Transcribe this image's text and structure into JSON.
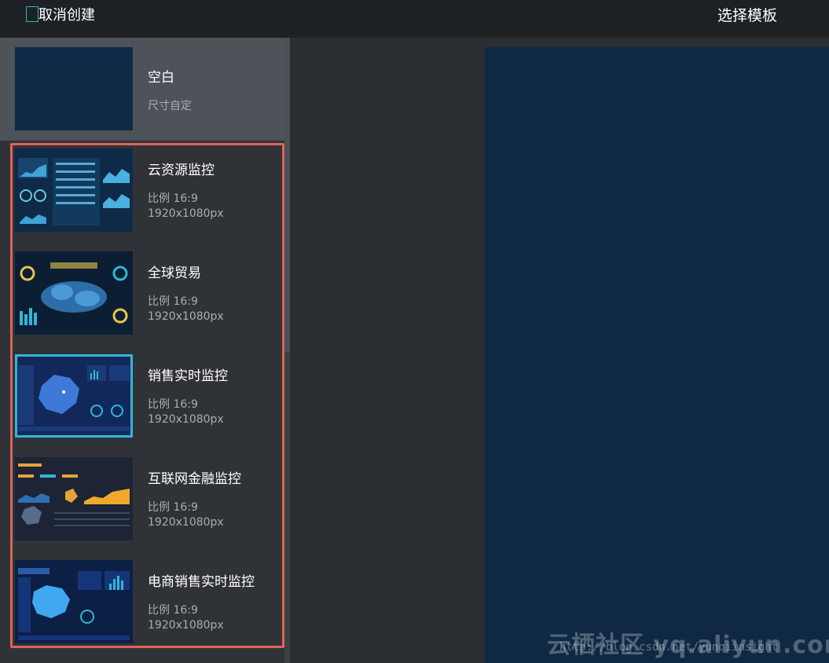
{
  "header": {
    "cancel_label": "取消创建",
    "title": "选择模板"
  },
  "blank": {
    "title": "空白",
    "subtitle": "尺寸自定"
  },
  "templates": [
    {
      "title": "云资源监控",
      "ratio": "比例 16:9",
      "size": "1920x1080px"
    },
    {
      "title": "全球贸易",
      "ratio": "比例 16:9",
      "size": "1920x1080px"
    },
    {
      "title": "销售实时监控",
      "ratio": "比例 16:9",
      "size": "1920x1080px"
    },
    {
      "title": "互联网金融监控",
      "ratio": "比例 16:9",
      "size": "1920x1080px"
    },
    {
      "title": "电商销售实时监控",
      "ratio": "比例 16:9",
      "size": "1920x1080px"
    }
  ],
  "selected_index": 2,
  "watermark": {
    "brand": "云栖社区 yq.aliyun.com",
    "url": "http://blog.csdn.net/yunqiinsight"
  },
  "colors": {
    "accent": "#2fb7d6",
    "highlight_border": "#e0625a",
    "canvas": "#0f2944"
  }
}
